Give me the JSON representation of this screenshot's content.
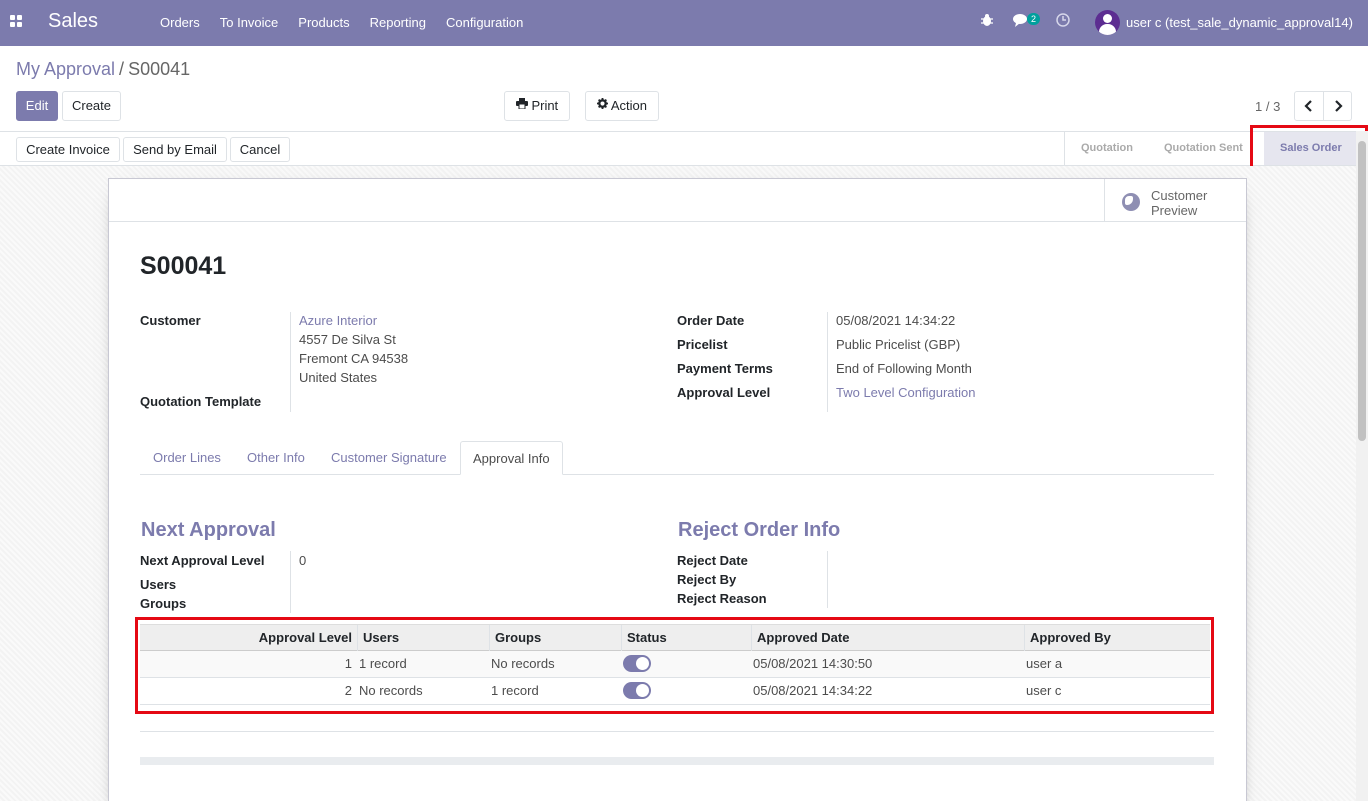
{
  "navbar": {
    "app_name": "Sales",
    "menu": [
      "Orders",
      "To Invoice",
      "Products",
      "Reporting",
      "Configuration"
    ],
    "chat_badge": "2",
    "user": "user c (test_sale_dynamic_approval14)",
    "icons": [
      "apps-icon",
      "bug-icon",
      "chat-icon",
      "clock-icon",
      "avatar"
    ]
  },
  "breadcrumb": {
    "parent": "My Approval",
    "separator": "/",
    "current": "S00041"
  },
  "control": {
    "edit": "Edit",
    "create": "Create",
    "print": "Print",
    "action": "Action",
    "pager": "1 / 3"
  },
  "statusbar": {
    "buttons": [
      "Create Invoice",
      "Send by Email",
      "Cancel"
    ],
    "stages": [
      "Quotation",
      "Quotation Sent",
      "Sales Order"
    ],
    "active_stage": "Sales Order"
  },
  "sheet": {
    "preview": [
      "Customer",
      "Preview"
    ],
    "title": "S00041",
    "left_fields": {
      "customer_label": "Customer",
      "customer_name": "Azure Interior",
      "address": [
        "4557 De Silva St",
        "Fremont CA 94538",
        "United States"
      ],
      "template_label": "Quotation Template"
    },
    "right_fields": [
      {
        "label": "Order Date",
        "value": "05/08/2021 14:34:22",
        "link": false
      },
      {
        "label": "Pricelist",
        "value": "Public Pricelist (GBP)",
        "link": false
      },
      {
        "label": "Payment Terms",
        "value": "End of Following Month",
        "link": false
      },
      {
        "label": "Approval Level",
        "value": "Two Level Configuration",
        "link": true
      }
    ],
    "tabs": [
      "Order Lines",
      "Other Info",
      "Customer Signature",
      "Approval Info"
    ],
    "active_tab": "Approval Info",
    "next_approval": {
      "title": "Next Approval",
      "level_label": "Next Approval Level",
      "level_value": "0",
      "users_label": "Users",
      "groups_label": "Groups"
    },
    "reject": {
      "title": "Reject Order Info",
      "date_label": "Reject Date",
      "by_label": "Reject By",
      "reason_label": "Reject Reason"
    },
    "table": {
      "headers": [
        "Approval Level",
        "Users",
        "Groups",
        "Status",
        "Approved Date",
        "Approved By"
      ],
      "rows": [
        {
          "level": "1",
          "users": "1 record",
          "groups": "No records",
          "status": true,
          "date": "05/08/2021 14:30:50",
          "by": "user a"
        },
        {
          "level": "2",
          "users": "No records",
          "groups": "1 record",
          "status": true,
          "date": "05/08/2021 14:34:22",
          "by": "user c"
        }
      ]
    }
  },
  "colors": {
    "brand": "#7c7bad",
    "highlight": "#e50914"
  }
}
